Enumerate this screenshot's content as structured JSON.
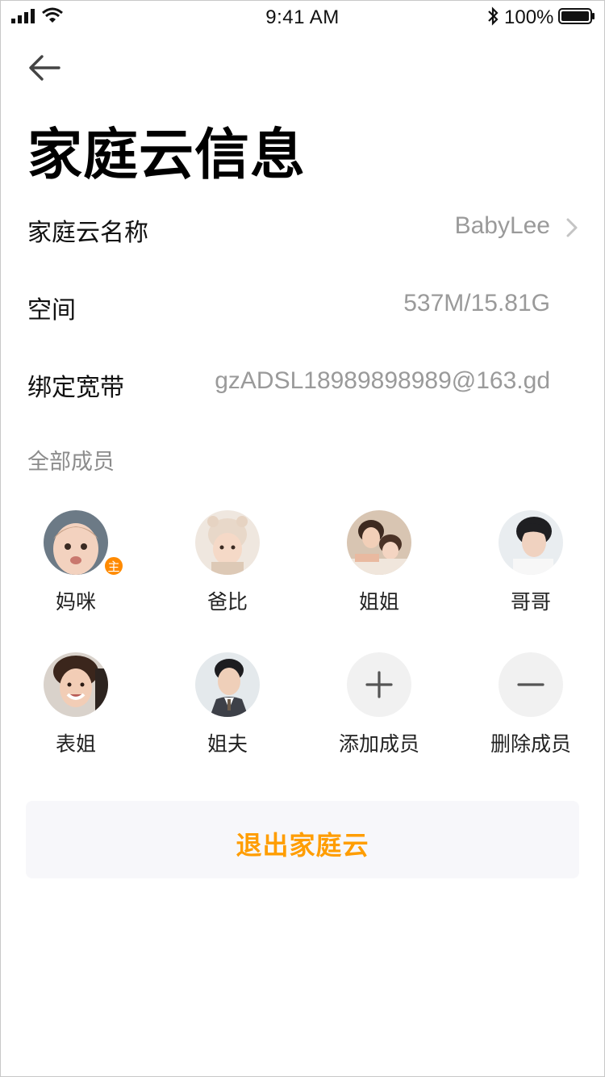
{
  "status_bar": {
    "time": "9:41 AM",
    "battery_percent": "100%"
  },
  "page": {
    "title": "家庭云信息"
  },
  "info_rows": [
    {
      "label": "家庭云名称",
      "value": "BabyLee"
    },
    {
      "label": "空间",
      "value": "537M/15.81G"
    },
    {
      "label": "绑定宽带",
      "value": "gzADSL18989898989@163.gd"
    }
  ],
  "members_section": {
    "title": "全部成员",
    "owner_badge": "主",
    "members": [
      {
        "name": "妈咪"
      },
      {
        "name": "爸比"
      },
      {
        "name": "姐姐"
      },
      {
        "name": "哥哥"
      },
      {
        "name": "表姐"
      },
      {
        "name": "姐夫"
      }
    ],
    "add_label": "添加成员",
    "remove_label": "删除成员"
  },
  "exit_button": {
    "label": "退出家庭云"
  },
  "colors": {
    "accent": "#ff9d00",
    "badge": "#ff8a00",
    "muted_text": "#9a9a9a"
  },
  "icons": [
    "back-arrow-icon",
    "chevron-right-icon",
    "plus-icon",
    "minus-icon",
    "signal-icon",
    "wifi-icon",
    "bluetooth-icon",
    "battery-icon"
  ]
}
